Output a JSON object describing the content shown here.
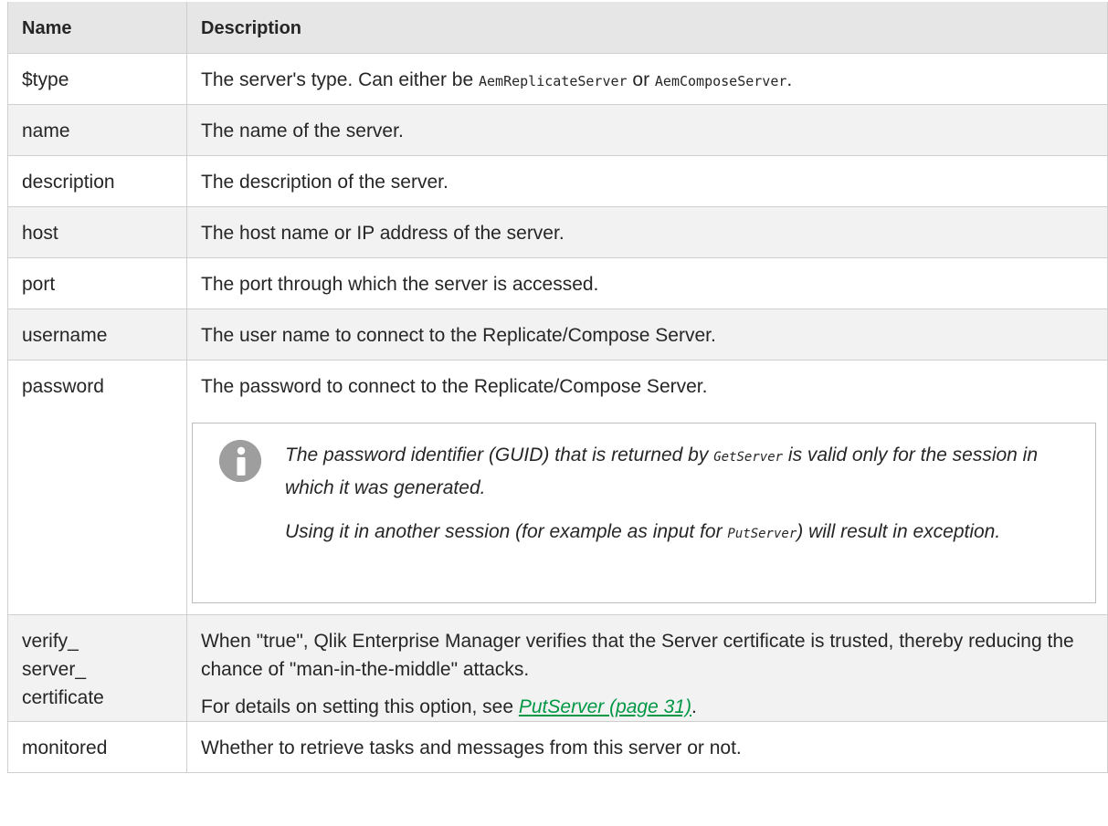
{
  "table": {
    "headers": {
      "name": "Name",
      "description": "Description"
    },
    "rows": {
      "type": {
        "name": "$type",
        "desc_prefix": "The server's type. Can either be ",
        "code1": "AemReplicateServer",
        "desc_or": " or ",
        "code2": "AemComposeServer",
        "desc_suffix": "."
      },
      "name": {
        "name": "name",
        "desc": "The name of the server."
      },
      "description": {
        "name": "description",
        "desc": "The description of the server."
      },
      "host": {
        "name": "host",
        "desc": "The host name or IP address of the server."
      },
      "port": {
        "name": "port",
        "desc": "The port through which the server is accessed."
      },
      "username": {
        "name": "username",
        "desc": "The user name to connect to the Replicate/Compose Server."
      },
      "password": {
        "name": "password",
        "desc": "The password to connect to the Replicate/Compose Server.",
        "note": {
          "p1_prefix": "The password identifier (GUID) that is returned by ",
          "p1_code": "GetServer",
          "p1_suffix": " is valid only for the session in which it was generated.",
          "p2_prefix": "Using it in another session (for example as input for ",
          "p2_code": "PutServer",
          "p2_suffix": ") will result in exception."
        }
      },
      "verify": {
        "name_line1": "verify_",
        "name_line2": "server_",
        "name_line3": "certificate",
        "desc": "When \"true\", Qlik Enterprise Manager verifies that the Server certificate is trusted, thereby reducing the chance of \"man-in-the-middle\" attacks.",
        "details_prefix": "For details on setting this option, see ",
        "details_link": "PutServer (page 31)",
        "details_suffix": "."
      },
      "monitored": {
        "name": "monitored",
        "desc": "Whether to retrieve tasks and messages from this server or not."
      }
    }
  },
  "icons": {
    "note": "info-icon"
  },
  "colors": {
    "link": "#009845",
    "header_bg": "#e6e6e6",
    "stripe_bg": "#f2f2f2"
  }
}
